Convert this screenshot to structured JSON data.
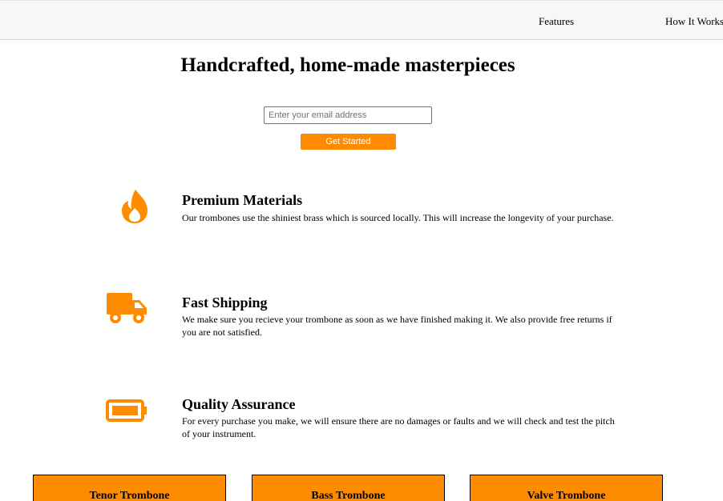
{
  "nav": {
    "features_label": "Features",
    "how_it_works_label": "How It Works"
  },
  "hero": {
    "title": "Handcrafted, home-made masterpieces",
    "email_placeholder": "Enter your email address",
    "cta_label": "Get Started"
  },
  "features": [
    {
      "icon": "fire-icon",
      "title": "Premium Materials",
      "description": "Our trombones use the shiniest brass which is sourced locally. This will increase the longevity of your purchase."
    },
    {
      "icon": "truck-icon",
      "title": "Fast Shipping",
      "description": "We make sure you recieve your trombone as soon as we have finished making it. We also provide free returns if you are not satisfied."
    },
    {
      "icon": "battery-icon",
      "title": "Quality Assurance",
      "description": "For every purchase you make, we will ensure there are no damages or faults and we will check and test the pitch of your instrument."
    }
  ],
  "products": [
    {
      "name": "Tenor Trombone"
    },
    {
      "name": "Bass Trombone"
    },
    {
      "name": "Valve Trombone"
    }
  ],
  "colors": {
    "accent": "#ff8c00",
    "header_bg": "#f7f7f7"
  }
}
